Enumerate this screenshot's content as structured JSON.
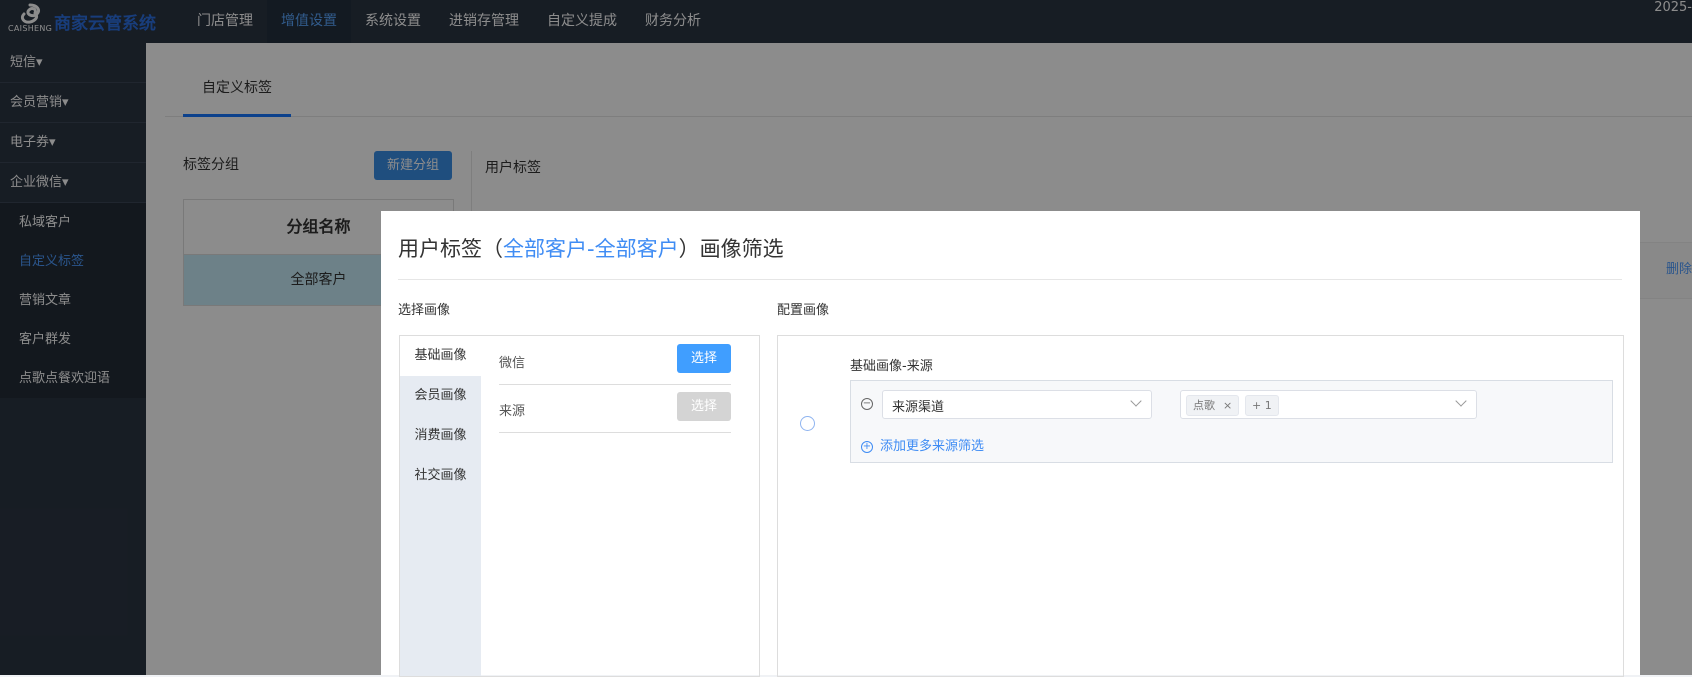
{
  "app": {
    "logo_text": "CAISHENG",
    "title": "商家云管系统",
    "date_fragment": "2025-"
  },
  "topnav": [
    {
      "label": "门店管理"
    },
    {
      "label": "增值设置",
      "active": true
    },
    {
      "label": "系统设置"
    },
    {
      "label": "进销存管理"
    },
    {
      "label": "自定义提成"
    },
    {
      "label": "财务分析"
    }
  ],
  "sidebar": {
    "groups": [
      "短信",
      "会员营销",
      "电子券",
      "企业微信"
    ],
    "sub_items": [
      {
        "label": "私域客户"
      },
      {
        "label": "自定义标签",
        "active": true
      },
      {
        "label": "营销文章"
      },
      {
        "label": "客户群发"
      },
      {
        "label": "点歌点餐欢迎语"
      }
    ]
  },
  "page": {
    "tab": "自定义标签",
    "group_title": "标签分组",
    "new_group_button": "新建分组",
    "table_header": "分组名称",
    "table_row": "全部客户",
    "user_tag_title": "用户标签",
    "delete_link": "删除"
  },
  "modal": {
    "title_prefix": "用户标签（",
    "title_highlight": "全部客户-全部客户",
    "title_suffix": "）画像筛选",
    "select_label": "选择画像",
    "config_label": "配置画像",
    "categories": [
      "基础画像",
      "会员画像",
      "消费画像",
      "社交画像"
    ],
    "options": [
      {
        "label": "微信",
        "button": "选择",
        "enabled": true
      },
      {
        "label": "来源",
        "button": "选择",
        "enabled": false
      }
    ],
    "config": {
      "title": "基础画像-来源",
      "field_select": "来源渠道",
      "tags": [
        "点歌",
        "+ 1"
      ],
      "add_more": "添加更多来源筛选"
    }
  },
  "colors": {
    "topbar_bg": "#2b3543",
    "accent": "#409eff",
    "link": "#3f8cf4"
  }
}
